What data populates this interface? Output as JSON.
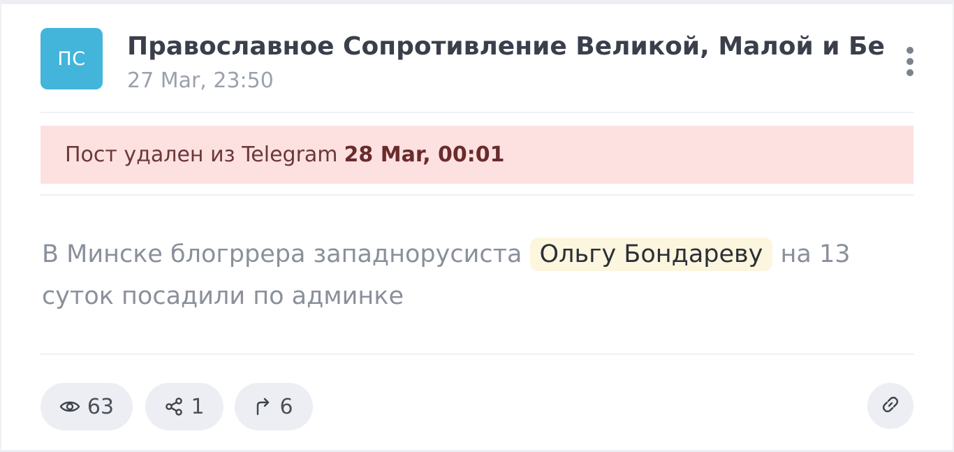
{
  "channel": {
    "avatar_text": "ПС",
    "avatar_color": "#43b5db",
    "title": "Православное Сопротивление Великой, Малой и Белой Руси",
    "date": "27 Mar, 23:50"
  },
  "alert": {
    "text": "Пост удален из Telegram",
    "date": "28 Mar, 00:01",
    "background": "#fde1e1"
  },
  "post": {
    "text_before": "В Минске блогррера западнорусиста ",
    "highlight": "Ольгу Бондареву",
    "text_after": " на 13 суток посадили по админке"
  },
  "stats": {
    "views": "63",
    "shares": "1",
    "forwards": "6"
  },
  "icons": {
    "views": "eye-icon",
    "shares": "share-icon",
    "forwards": "forward-arrow-icon",
    "link": "link-icon",
    "menu": "kebab-menu-icon"
  }
}
